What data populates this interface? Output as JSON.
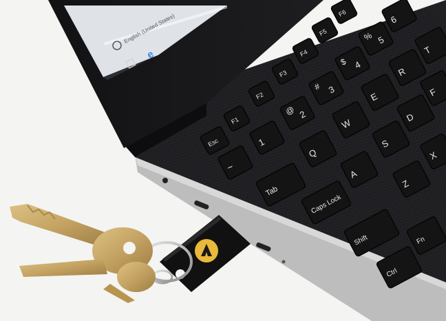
{
  "screen": {
    "language_label": "English (United States)"
  },
  "keys": {
    "esc": "Esc",
    "f1": "F1",
    "f2": "F2",
    "f3": "F3",
    "f4": "F4",
    "f5": "F5",
    "f6": "F6",
    "tilde": "~",
    "one": "1",
    "two": "2",
    "three": "3",
    "four": "4",
    "five": "5",
    "six": "6",
    "at": "@",
    "hash": "#",
    "dollar": "$",
    "percent": "%",
    "tab": "Tab",
    "q": "Q",
    "w": "W",
    "e": "E",
    "r": "R",
    "t": "T",
    "caps": "Caps Lock",
    "a": "A",
    "s": "S",
    "d": "D",
    "f": "F",
    "shift": "Shift",
    "z": "Z",
    "x": "X",
    "ctrl": "Ctrl",
    "fn": "Fn"
  },
  "colors": {
    "background": "#f3f3f1",
    "laptop_body": "#1c1c1e",
    "keycap": "#141414",
    "key_legend": "#e8e8e8",
    "security_key_logo": "#e8b93a",
    "brass_key": "#c9a866"
  }
}
